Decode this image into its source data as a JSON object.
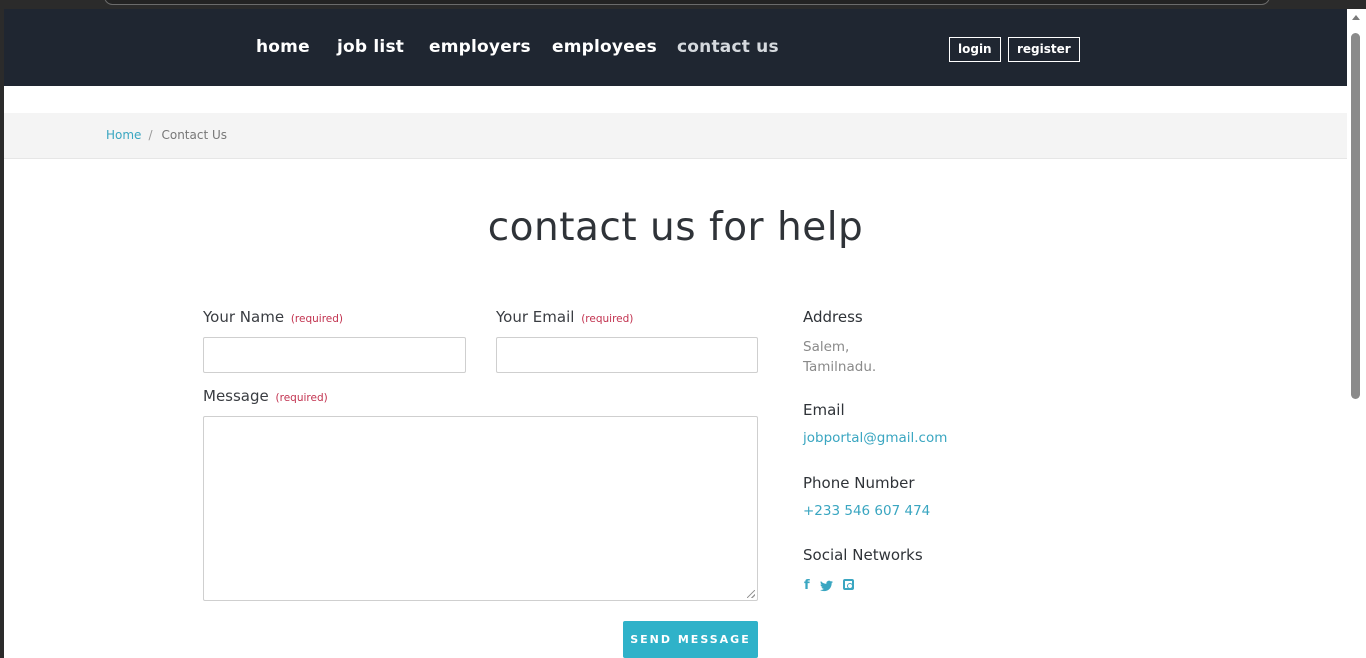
{
  "nav": {
    "links": [
      "home",
      "job list",
      "employers",
      "employees",
      "contact us"
    ],
    "login_label": "login",
    "register_label": "register"
  },
  "breadcrumb": {
    "home": "Home",
    "separator": "/",
    "current": "Contact Us"
  },
  "page": {
    "heading": "contact us for help"
  },
  "form": {
    "name_label": "Your Name",
    "email_label": "Your Email",
    "message_label": "Message",
    "required_text": "(required)",
    "name_value": "",
    "email_value": "",
    "message_value": "",
    "send_label": "SEND MESSAGE"
  },
  "contact_info": {
    "address_title": "Address",
    "address_line1": "Salem,",
    "address_line2": "Tamilnadu.",
    "email_title": "Email",
    "email_value": "jobportal@gmail.com",
    "phone_title": "Phone Number",
    "phone_value": "+233 546 607 474",
    "social_title": "Social Networks",
    "social_icons": [
      "facebook-icon",
      "twitter-icon",
      "instagram-icon"
    ]
  },
  "colors": {
    "navbar_bg": "#1f2631",
    "accent": "#2fb2c9",
    "link": "#3aa6c1",
    "required": "#c2324f"
  }
}
